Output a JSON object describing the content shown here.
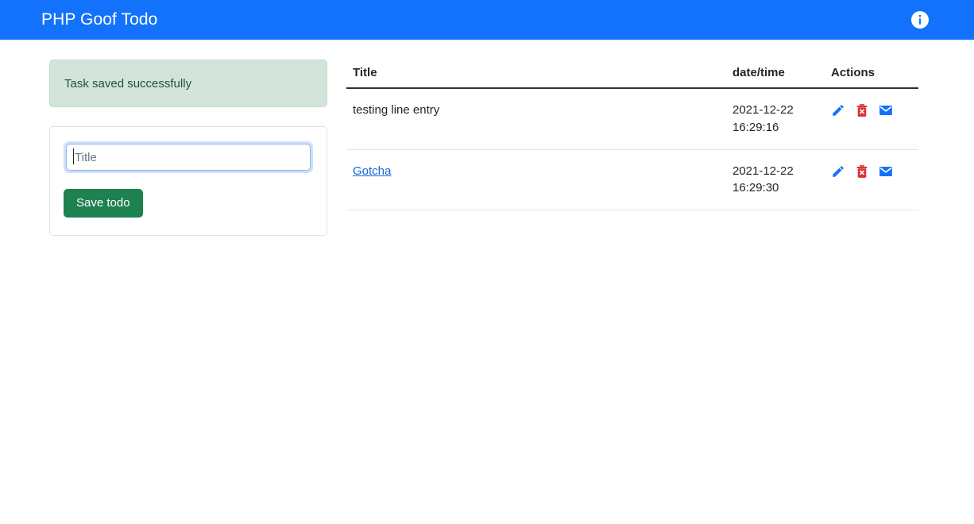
{
  "appbar": {
    "title": "PHP Goof Todo",
    "info_icon_name": "info-icon"
  },
  "alert": {
    "message": "Task saved successfully",
    "bg_color": "#d3e5da",
    "text_color": "#1b5533"
  },
  "form": {
    "title_placeholder": "Title",
    "title_value": "",
    "save_label": "Save todo",
    "save_color": "#1e8150"
  },
  "table": {
    "columns": [
      "Title",
      "date/time",
      "Actions"
    ],
    "rows": [
      {
        "title": "testing line entry",
        "is_link": false,
        "date": "2021-12-22",
        "time": "16:29:16",
        "actions": [
          "edit-pencil-icon",
          "delete-trash-icon",
          "mail-envelope-icon"
        ]
      },
      {
        "title": "Gotcha",
        "is_link": true,
        "date": "2021-12-22",
        "time": "16:29:30",
        "actions": [
          "edit-pencil-icon",
          "delete-trash-icon",
          "mail-envelope-icon"
        ]
      }
    ]
  },
  "colors": {
    "appbar_blue": "#1272fb",
    "link_blue": "#1866d6",
    "icon_blue": "#1272fb",
    "icon_red": "#e03131"
  }
}
